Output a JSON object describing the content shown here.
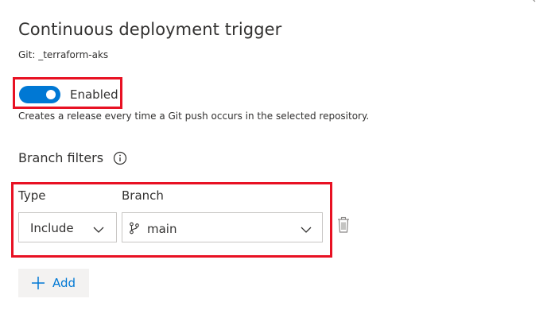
{
  "panel": {
    "title": "Continuous deployment trigger",
    "subtitle": "Git: _terraform-aks"
  },
  "trigger": {
    "toggle_label": "Enabled",
    "toggle_on": true,
    "description": "Creates a release every time a Git push occurs in the selected repository."
  },
  "branch_filters": {
    "heading": "Branch filters",
    "columns": {
      "type": "Type",
      "branch": "Branch"
    },
    "rows": [
      {
        "type": "Include",
        "branch": "main"
      }
    ],
    "add_label": "Add"
  },
  "icons": {
    "corner": "chevron-icon",
    "info": "info-icon",
    "dropdown": "chevron-down-icon",
    "branch": "git-branch-icon",
    "delete": "trash-icon",
    "add": "plus-icon"
  },
  "colors": {
    "accent": "#0078d4",
    "highlight": "#e81123",
    "text": "#323130",
    "border": "#c8c6c4",
    "button_bg": "#f3f2f1"
  }
}
